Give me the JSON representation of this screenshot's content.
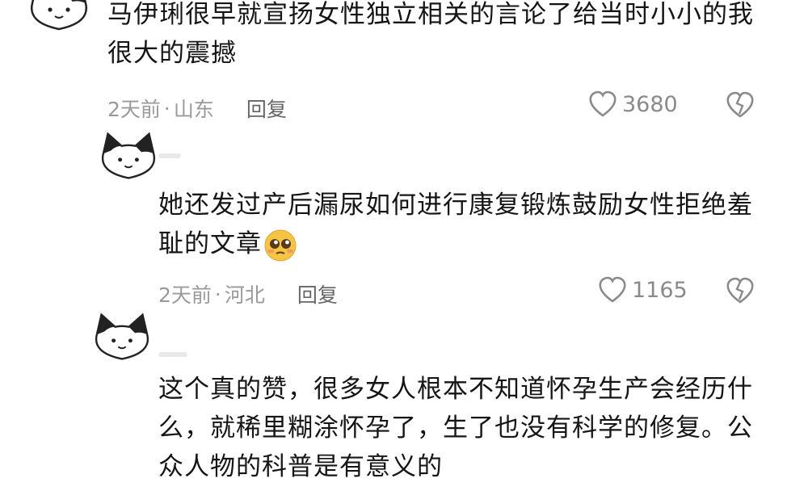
{
  "comments": [
    {
      "text": "马伊琍很早就宣扬女性独立相关的言论了给当时小小的我很大的震撼",
      "time": "2天前",
      "sep": "·",
      "location": "山东",
      "reply_label": "回复",
      "likes": "3680"
    },
    {
      "text": "她还发过产后漏尿如何进行康复锻炼鼓励女性拒绝羞耻的文章",
      "time": "2天前",
      "sep": "·",
      "location": "河北",
      "reply_label": "回复",
      "likes": "1165"
    },
    {
      "text": "这个真的赞，很多女人根本不知道怀孕生产会经历什么，就稀里糊涂怀孕了，生了也没有科学的修复。公众人物的科普是有意义的"
    }
  ],
  "icons": {
    "avatar": "cat-avatar-icon",
    "like": "heart-outline-icon",
    "dislike": "broken-heart-icon",
    "emoji": "pleading-face-emoji"
  }
}
